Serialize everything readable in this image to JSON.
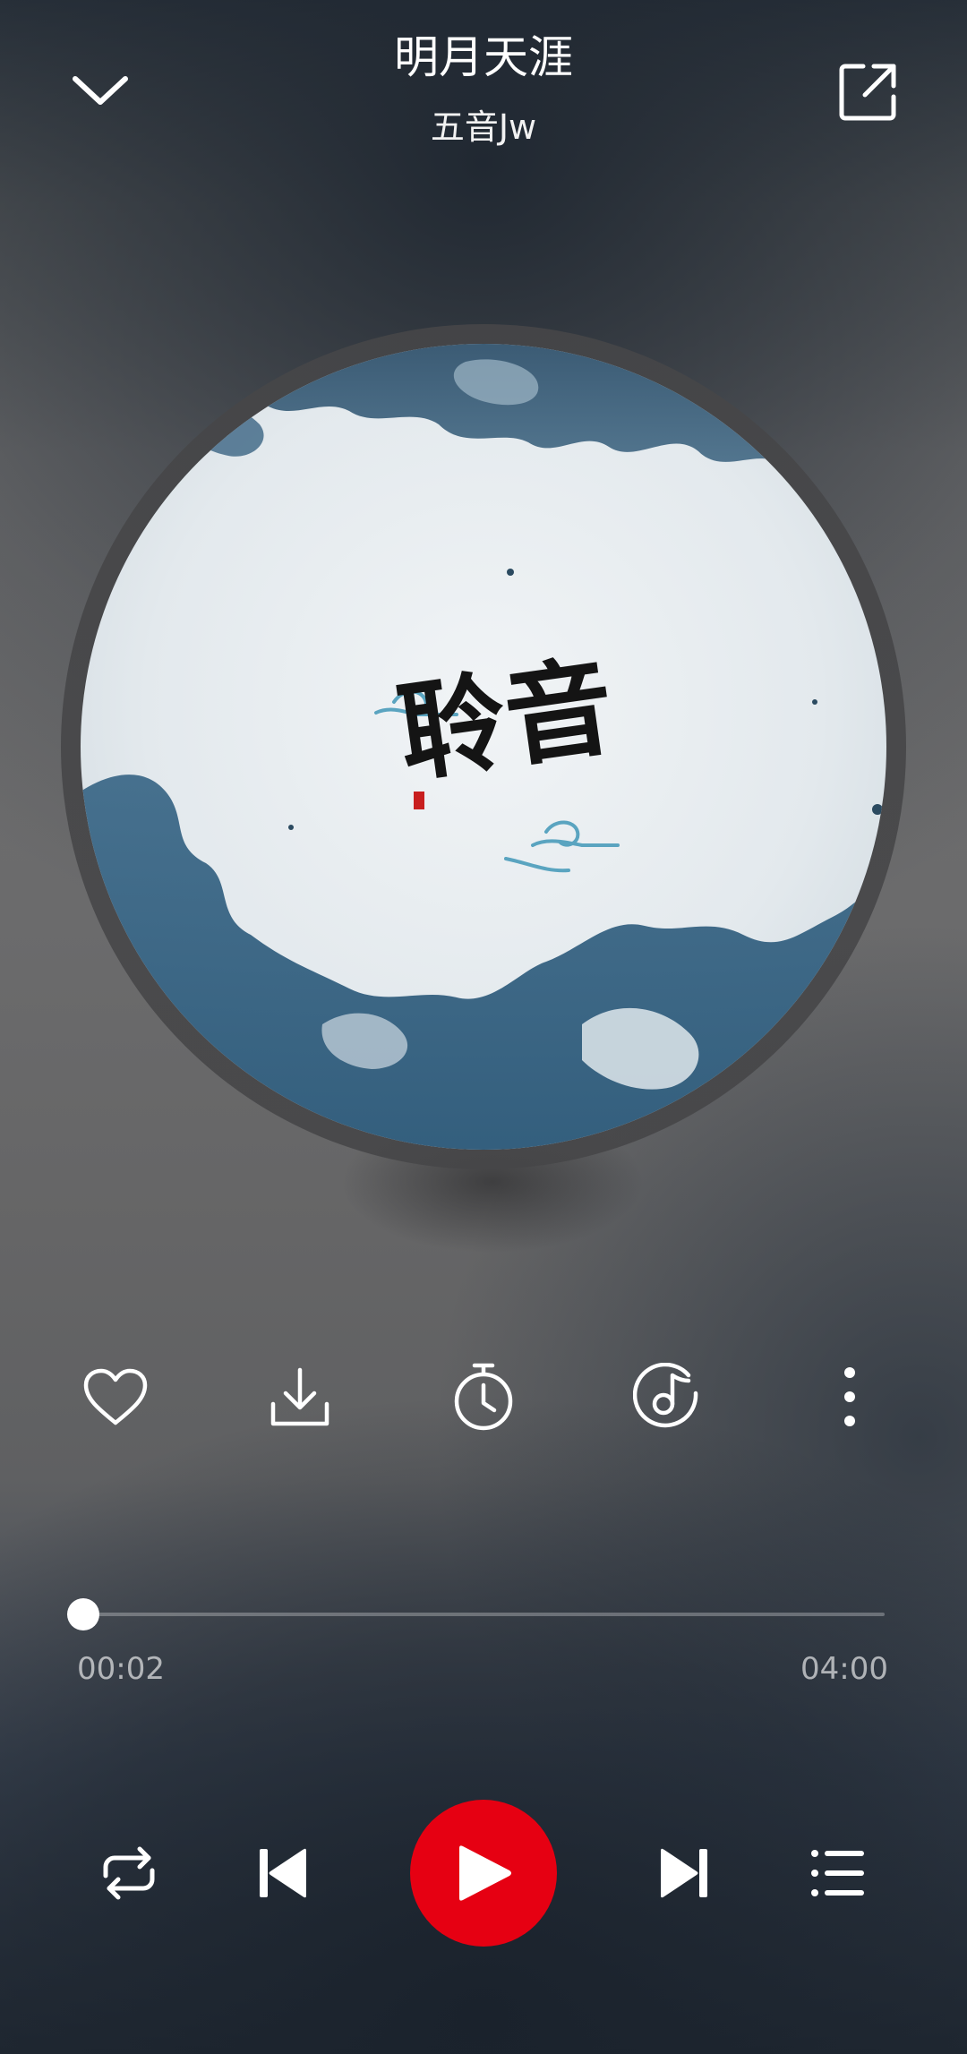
{
  "song": {
    "title": "明月天涯",
    "artist": "五音Jw"
  },
  "cover": {
    "calligraphy_text": "聆音"
  },
  "actions": [
    {
      "name": "like",
      "icon": "heart-icon"
    },
    {
      "name": "download",
      "icon": "download-icon"
    },
    {
      "name": "sleep-timer",
      "icon": "timer-icon"
    },
    {
      "name": "sound-effect",
      "icon": "music-note-circle-icon"
    },
    {
      "name": "more",
      "icon": "more-vertical-icon"
    }
  ],
  "progress": {
    "current": "00:02",
    "total": "04:00",
    "fraction": 0.008
  },
  "controls": {
    "mode_icon": "repeat-icon",
    "prev_icon": "previous-icon",
    "play_icon": "play-icon",
    "next_icon": "next-icon",
    "playlist_icon": "playlist-icon"
  },
  "colors": {
    "accent": "#e60012",
    "text": "#ffffff",
    "ink_blue": "#2f5d7e"
  }
}
